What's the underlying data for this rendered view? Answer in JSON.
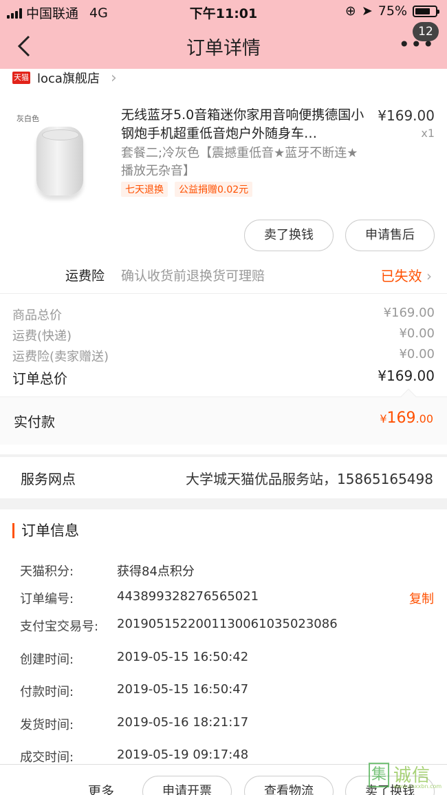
{
  "status_bar": {
    "carrier": "中国联通",
    "network": "4G",
    "time": "下午11:01",
    "battery": "75%",
    "battery_level": 0.75
  },
  "nav": {
    "title": "订单详情",
    "badge": "12"
  },
  "shop": {
    "name": "loca旗舰店",
    "tmall_label": "天猫"
  },
  "product": {
    "image_caption": "灰白色",
    "title": "无线蓝牙5.0音箱迷你家用音响便携德国小钢炮手机超重低音炮户外随身车…",
    "price": "¥169.00",
    "quantity": "x1",
    "sku": "套餐二;冷灰色【震撼重低音★蓝牙不断连★播放无杂音】",
    "tags": [
      "七天退换",
      "公益捐赠0.02元"
    ]
  },
  "actions": {
    "sell": "卖了换钱",
    "after_sale": "申请售后"
  },
  "insurance": {
    "label": "运费险",
    "desc": "确认收货前退换货可理赔",
    "state": "已失效"
  },
  "fees": [
    {
      "label": "商品总价",
      "value": "¥169.00"
    },
    {
      "label": "运费(快递)",
      "value": "¥0.00"
    },
    {
      "label": "运费险(卖家赠送)",
      "value": "¥0.00"
    }
  ],
  "order_total": {
    "label": "订单总价",
    "value": "¥169.00"
  },
  "paid": {
    "label": "实付款",
    "currency": "¥",
    "integer": "169",
    "decimal": ".00"
  },
  "service": {
    "label": "服务网点",
    "value": "大学城天猫优品服务站，15865165498"
  },
  "order_info": {
    "title": "订单信息",
    "rows": [
      {
        "key": "天猫积分:",
        "value": "获得84点积分"
      },
      {
        "key": "订单编号:",
        "value": "443899328276565021",
        "action": "复制"
      },
      {
        "key": "支付宝交易号:",
        "value": "2019051522001130061035023086"
      },
      {
        "key": "创建时间:",
        "value": "2019-05-15 16:50:42"
      },
      {
        "key": "付款时间:",
        "value": "2019-05-15 16:50:47"
      },
      {
        "key": "发货时间:",
        "value": "2019-05-16 18:21:17"
      },
      {
        "key": "成交时间:",
        "value": "2019-05-19 09:17:48"
      }
    ]
  },
  "bottom_bar": {
    "more": "更多",
    "invoice": "申请开票",
    "logistics": "查看物流",
    "sell": "卖了换钱"
  },
  "watermark": {
    "logo_char": "集",
    "text": "诚信",
    "sub": "www.cnxxbn.com"
  }
}
